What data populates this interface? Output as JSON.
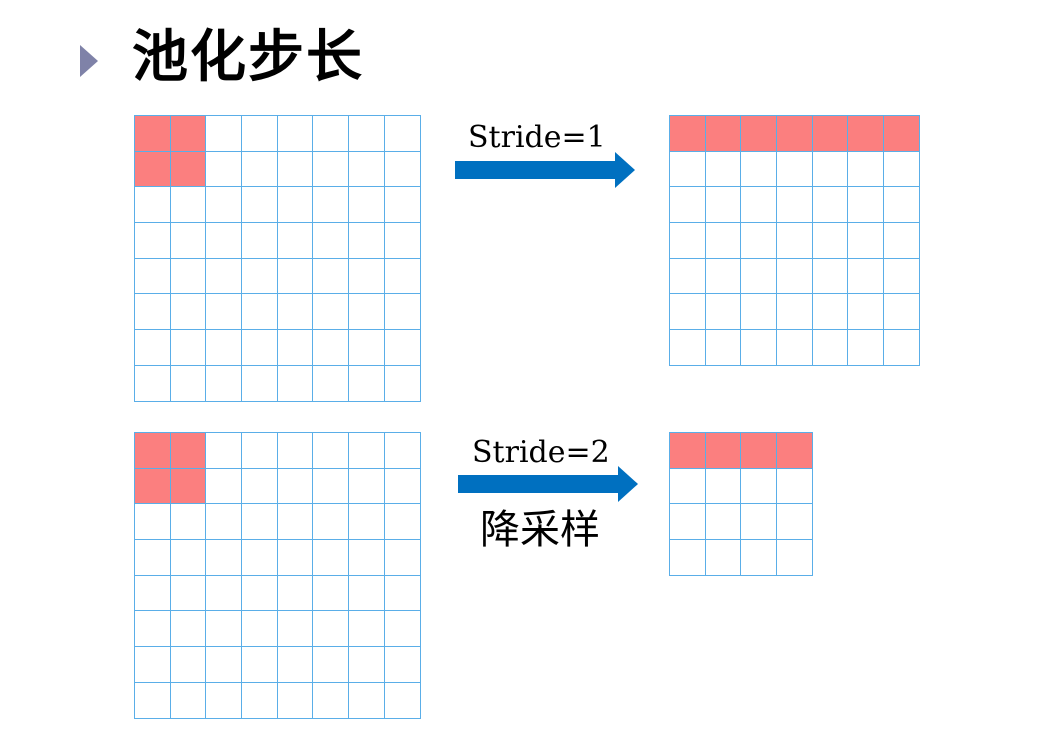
{
  "slide": {
    "title": "池化步长",
    "bullet_icon": "triangle-bullet-icon",
    "colors": {
      "grid_line": "#5aaee8",
      "highlight": "#fb7f7f",
      "arrow": "#0070c0",
      "bullet": "#7f82a8"
    }
  },
  "rows": [
    {
      "input_grid": {
        "rows": 8,
        "cols": 8,
        "highlight": "top-left 2x2"
      },
      "stride_label": "Stride=1",
      "arrow_icon": "right-arrow-icon",
      "note": "",
      "output_grid": {
        "rows": 7,
        "cols": 7,
        "highlight": "first row"
      }
    },
    {
      "input_grid": {
        "rows": 8,
        "cols": 8,
        "highlight": "top-left 2x2"
      },
      "stride_label": "Stride=2",
      "arrow_icon": "right-arrow-icon",
      "note": "降采样",
      "output_grid": {
        "rows": 4,
        "cols": 4,
        "highlight": "first row"
      }
    }
  ]
}
